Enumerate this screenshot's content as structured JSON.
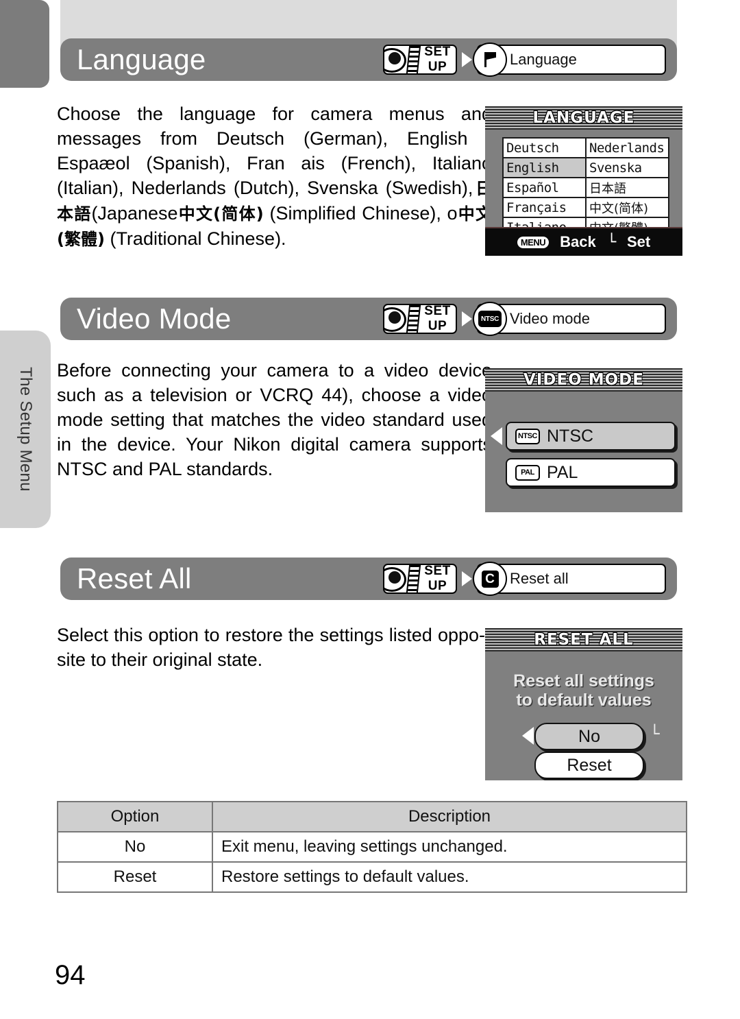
{
  "page": {
    "number": "94",
    "side_tab_label": "The Setup Menu"
  },
  "sections": [
    {
      "id": "language",
      "title": "Language",
      "crumb_setup": "SET UP",
      "crumb_item": "Language",
      "crumb_icon": "flag-icon",
      "body": "Choose the language for camera menus and messages from  Deutsch  (German), English ,  Espaæol (Spanish),  Fran ais    (French),  Italiano    (Italian),  Nederlands (Dutch), Svenska (Swedish),",
      "body2": "(Japanese",
      "body3": "(Simplified Chinese), o",
      "body4": "(Traditional Chinese).",
      "cjk1": "日本語",
      "cjk2": "中文(简体)",
      "cjk3": "中文(繁體)"
    },
    {
      "id": "video-mode",
      "title": "Video Mode",
      "crumb_setup": "SET UP",
      "crumb_item": "Video mode",
      "crumb_icon": "ntsc-icon",
      "body": "Before connecting your camera to a video device such as a television or VCRQ  44), choose a video mode setting that matches the video standard used in the device. Your Nikon digital camera supports NTSC and PAL standards."
    },
    {
      "id": "reset-all",
      "title": "Reset All",
      "crumb_setup": "SET UP",
      "crumb_item": "Reset all",
      "crumb_icon": "reset-c-icon",
      "body": "Select this option to restore the settings listed oppo-site to their original state."
    }
  ],
  "lcd_language": {
    "title": "LANGUAGE",
    "options_left": [
      "Deutsch",
      "English",
      "Español",
      "Français",
      "Italiano"
    ],
    "options_right": [
      "Nederlands",
      "Svenska",
      "日本語",
      "中文(简体)",
      "中文(繁體)"
    ],
    "selected": "English",
    "footer_menu_chip": "MENU",
    "footer_back": "Back",
    "footer_set": "Set"
  },
  "lcd_video_mode": {
    "title": "VIDEO MODE",
    "options": [
      {
        "badge": "NTSC",
        "label": "NTSC",
        "selected": true
      },
      {
        "badge": "PAL",
        "label": "PAL",
        "selected": false
      }
    ]
  },
  "lcd_reset_all": {
    "title": "RESET ALL",
    "message_line1": "Reset all settings",
    "message_line2": "to default values",
    "buttons": [
      {
        "label": "No",
        "selected": true
      },
      {
        "label": "Reset",
        "selected": false
      }
    ]
  },
  "options_table": {
    "headers": [
      "Option",
      "Description"
    ],
    "rows": [
      [
        "No",
        "Exit menu, leaving settings unchanged."
      ],
      [
        "Reset",
        "Restore settings to default values."
      ]
    ]
  },
  "colors": {
    "section_bar": "#7e7e7e",
    "lcd_background": "#808080",
    "tab_gray": "#cfcfcf",
    "corner_tab": "#7c7c7c"
  }
}
